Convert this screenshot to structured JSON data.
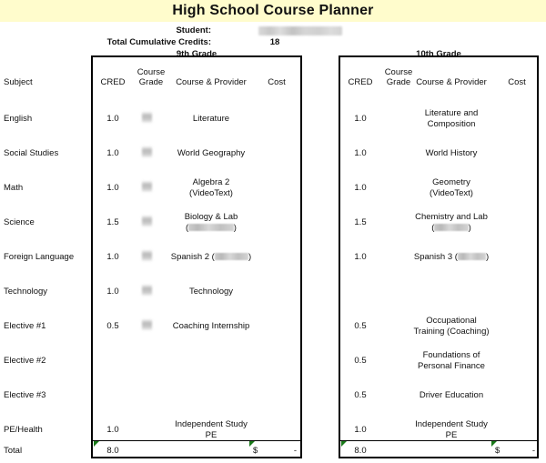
{
  "title": "High School Course Planner",
  "header": {
    "student_label": "Student:",
    "student_value": "",
    "credits_label": "Total Cumulative Credits:",
    "credits_value": "18"
  },
  "columns": {
    "subject": "Subject",
    "cred": "CRED",
    "course_grade_line1": "Course",
    "course_grade_line2": "Grade",
    "course_provider": "Course & Provider",
    "cost": "Cost"
  },
  "subjects": [
    "English",
    "Social Studies",
    "Math",
    "Science",
    "Foreign Language",
    "Technology",
    "Elective #1",
    "Elective #2",
    "Elective #3",
    "PE/Health",
    "Total"
  ],
  "grade9": {
    "title": "9th Grade",
    "rows": [
      {
        "cred": "1.0",
        "grade_redacted": true,
        "course": "Literature",
        "cost": ""
      },
      {
        "cred": "1.0",
        "grade_redacted": true,
        "course": "World Geography",
        "cost": ""
      },
      {
        "cred": "1.0",
        "grade_redacted": true,
        "course": "Algebra 2\n(VideoText)",
        "cost": ""
      },
      {
        "cred": "1.5",
        "grade_redacted": true,
        "course": "Biology & Lab\n(████████)",
        "cost": ""
      },
      {
        "cred": "1.0",
        "grade_redacted": true,
        "course": "Spanish 2 (██████)",
        "cost": ""
      },
      {
        "cred": "1.0",
        "grade_redacted": true,
        "course": "Technology",
        "cost": ""
      },
      {
        "cred": "0.5",
        "grade_redacted": true,
        "course": "Coaching Internship",
        "cost": ""
      },
      {
        "cred": "",
        "grade_redacted": false,
        "course": "",
        "cost": ""
      },
      {
        "cred": "",
        "grade_redacted": false,
        "course": "",
        "cost": ""
      },
      {
        "cred": "1.0",
        "grade_redacted": false,
        "course": "Independent Study\nPE",
        "cost": ""
      }
    ],
    "total": {
      "label": "Total",
      "cred": "8.0",
      "cost_symbol": "$",
      "cost": "-"
    }
  },
  "grade10": {
    "title": "10th Grade",
    "rows": [
      {
        "cred": "1.0",
        "grade_redacted": false,
        "course": "Literature and\nComposition",
        "cost": ""
      },
      {
        "cred": "1.0",
        "grade_redacted": false,
        "course": "World History",
        "cost": ""
      },
      {
        "cred": "1.0",
        "grade_redacted": false,
        "course": "Geometry\n(VideoText)",
        "cost": ""
      },
      {
        "cred": "1.5",
        "grade_redacted": false,
        "course": "Chemistry and Lab\n(██████)",
        "cost": ""
      },
      {
        "cred": "1.0",
        "grade_redacted": false,
        "course": "Spanish 3 (█████)",
        "cost": ""
      },
      {
        "cred": "",
        "grade_redacted": false,
        "course": "",
        "cost": ""
      },
      {
        "cred": "0.5",
        "grade_redacted": false,
        "course": "Occupational\nTraining (Coaching)",
        "cost": ""
      },
      {
        "cred": "0.5",
        "grade_redacted": false,
        "course": "Foundations of\nPersonal Finance",
        "cost": ""
      },
      {
        "cred": "0.5",
        "grade_redacted": false,
        "course": "Driver Education",
        "cost": ""
      },
      {
        "cred": "1.0",
        "grade_redacted": false,
        "course": "Independent Study\nPE",
        "cost": ""
      }
    ],
    "total": {
      "label": "Total",
      "cred": "8.0",
      "cost_symbol": "$",
      "cost": "-"
    }
  },
  "colors": {
    "title_bg": "#fffccc",
    "border": "#000000",
    "flag_green": "#1a7a1a",
    "text": "#111111"
  }
}
